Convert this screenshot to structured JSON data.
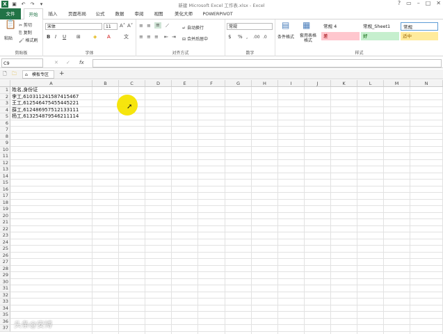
{
  "window": {
    "title": "新建 Microsoft Excel 工作表.xlsx - Excel"
  },
  "qat": {
    "undo": "↶",
    "redo": "↷",
    "more": "▾"
  },
  "tabs": [
    "文件",
    "开始",
    "插入",
    "页面布局",
    "公式",
    "数据",
    "审阅",
    "视图",
    "美化大师",
    "POWERPIVOT"
  ],
  "ribbon": {
    "clipboard": {
      "paste": "粘贴",
      "cut": "剪切",
      "copy": "复制",
      "format_painter": "格式刷",
      "label": "剪贴板"
    },
    "font": {
      "name": "宋体",
      "size": "11",
      "bold": "B",
      "italic": "I",
      "underline": "U",
      "label": "字体"
    },
    "alignment": {
      "wrap": "自动换行",
      "merge": "合并后居中",
      "label": "对齐方式"
    },
    "number": {
      "format": "常规",
      "label": "数字"
    },
    "styles": {
      "conditional": "条件格式",
      "table": "套用表格格式",
      "cells": [
        "常规 4",
        "常规_Sheet1",
        "常规",
        "差",
        "好",
        "适中"
      ],
      "label": "样式"
    }
  },
  "formula_bar": {
    "namebox": "C9",
    "fx": "fx",
    "value": ""
  },
  "workbook_tab": {
    "label": "模板专区",
    "add": "+"
  },
  "columns": [
    "A",
    "B",
    "C",
    "D",
    "E",
    "F",
    "G",
    "H",
    "I",
    "J",
    "K",
    "L",
    "M",
    "N"
  ],
  "rows": [
    "1",
    "2",
    "3",
    "4",
    "5",
    "6",
    "7",
    "8",
    "9",
    "10",
    "11",
    "12",
    "13",
    "14",
    "15",
    "16",
    "17",
    "18",
    "19",
    "20",
    "21",
    "22",
    "23",
    "24",
    "25",
    "26",
    "27",
    "28",
    "29",
    "30",
    "31",
    "32",
    "33",
    "34",
    "35",
    "36",
    "37"
  ],
  "cells": [
    "姓名,身份证",
    "李工,610311241587415467",
    "王工,612546475455445221",
    "薛工,612486957512133111",
    "杨工,613254879546211114"
  ],
  "watermark": "头条@安博"
}
